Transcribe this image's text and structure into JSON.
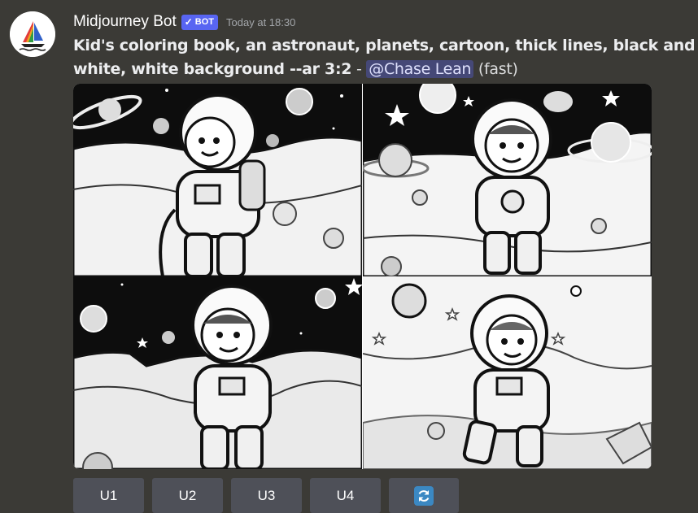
{
  "message": {
    "author": "Midjourney Bot",
    "badge": {
      "check": "✓",
      "label": "BOT"
    },
    "timestamp": "Today at 18:30",
    "prompt": "Kid's coloring book, an astronaut, planets, cartoon, thick lines, black and white, white background --ar 3:2",
    "separator": " - ",
    "mention": "@Chase Lean",
    "mode": "(fast)"
  },
  "image": {
    "quadrants": [
      {
        "icon": "astronaut-coloring-image-1"
      },
      {
        "icon": "astronaut-coloring-image-2"
      },
      {
        "icon": "astronaut-coloring-image-3"
      },
      {
        "icon": "astronaut-coloring-image-4"
      }
    ]
  },
  "buttons": {
    "u1": "U1",
    "u2": "U2",
    "u3": "U3",
    "u4": "U4",
    "reroll_icon": "refresh-icon"
  },
  "colors": {
    "background": "#3b3a36",
    "button": "#4e5058",
    "badge": "#5865f2",
    "mention_bg": "#5865f259",
    "reroll": "#3b88c3"
  }
}
